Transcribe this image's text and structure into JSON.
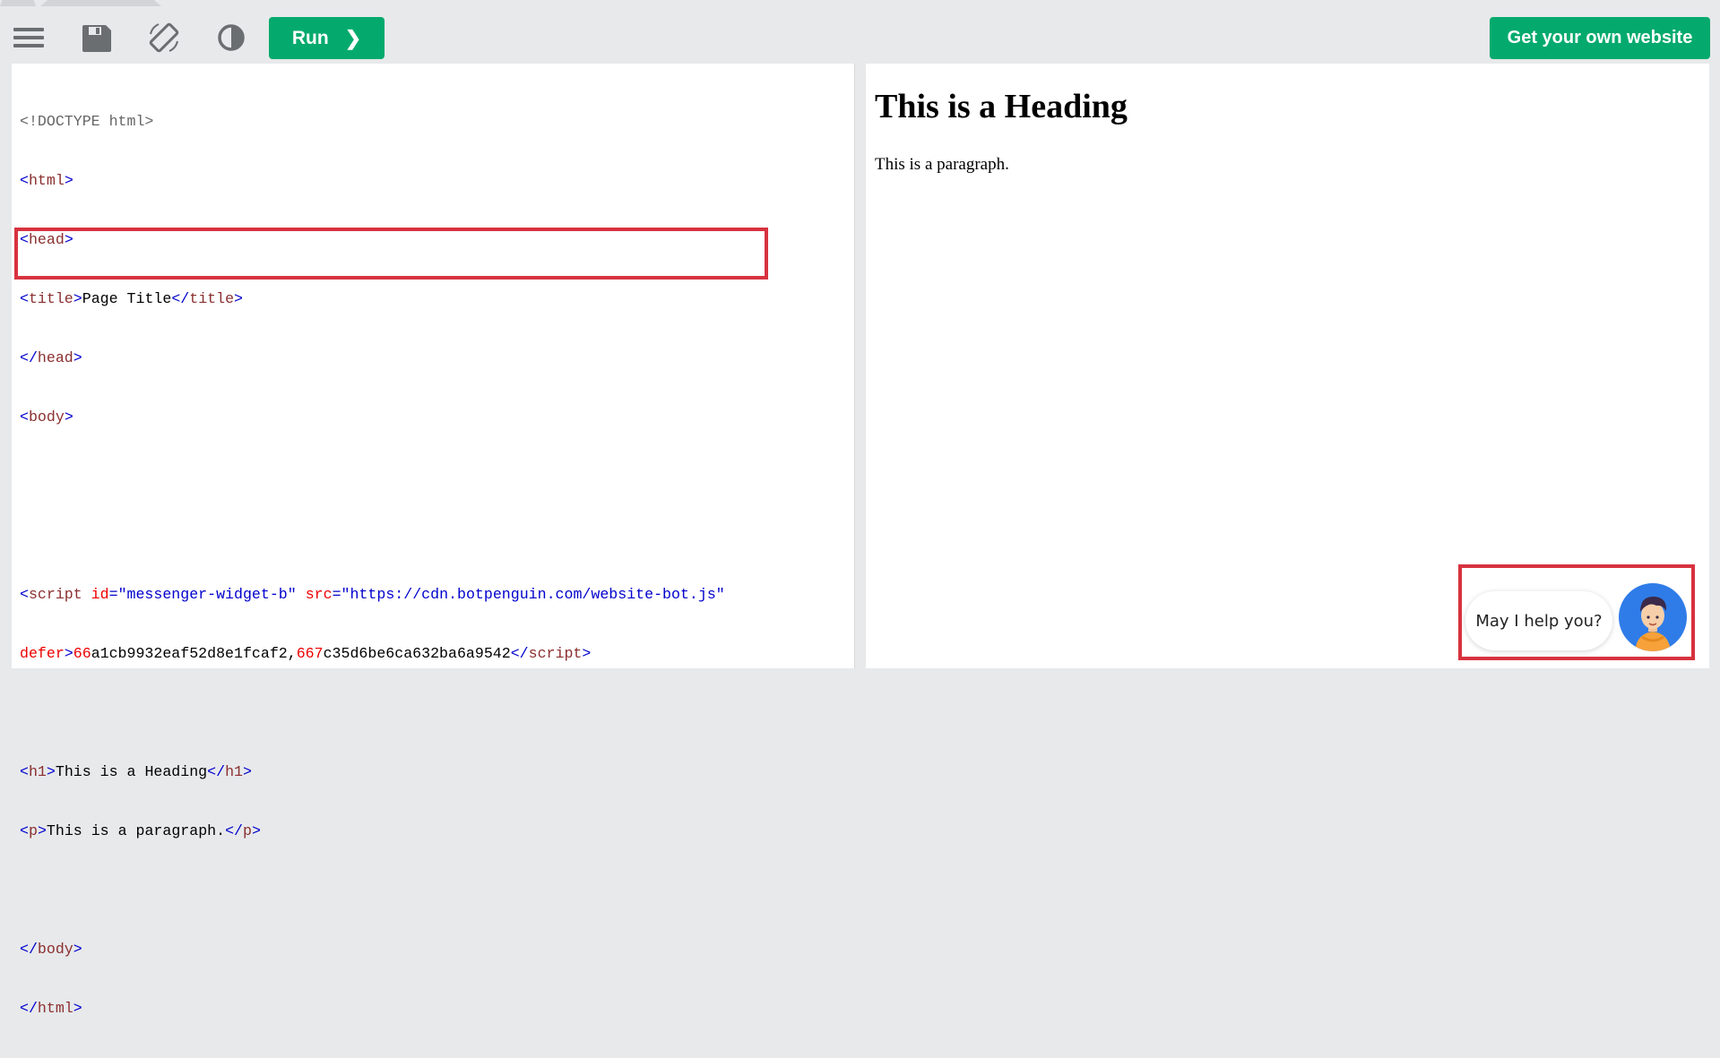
{
  "toolbar": {
    "run_label": "Run",
    "run_chevron": "❯",
    "own_website_label": "Get your own website",
    "icons": [
      "menu-icon",
      "save-icon",
      "rotate-icon",
      "theme-contrast-icon",
      "chevron-right-icon"
    ],
    "accent_color": "#04aa6d"
  },
  "editor": {
    "lines": {
      "l1": "<!DOCTYPE html>",
      "l2_open": "<",
      "l2_tag": "html",
      "l2_close": ">",
      "l3_open": "<",
      "l3_tag": "head",
      "l3_close": ">",
      "l4_open": "<",
      "l4_tag": "title",
      "l4_gt": ">",
      "l4_text": "Page Title",
      "l4_endopen": "</",
      "l4_endtag": "title",
      "l4_endgt": ">",
      "l5_open": "</",
      "l5_tag": "head",
      "l5_close": ">",
      "l6_open": "<",
      "l6_tag": "body",
      "l6_close": ">",
      "l9_open": "<",
      "l9_tag": "script",
      "l9_attr1": " id",
      "l9_eq1": "=",
      "l9_val1": "\"messenger-widget-b\"",
      "l9_attr2": " src",
      "l9_eq2": "=",
      "l9_val2": "\"https://cdn.botpenguin.com/website-bot.js\"",
      "l10_attr": "defer",
      "l10_gt": ">",
      "l10_num1": "66",
      "l10_t1": "a1cb9932eaf52d8e1fcaf2,",
      "l10_num2": "667",
      "l10_t2": "c35d6be6ca632ba6a9542",
      "l10_endopen": "</",
      "l10_endtag": "script",
      "l10_endgt": ">",
      "l12_open": "<",
      "l12_tag": "h1",
      "l12_gt": ">",
      "l12_text": "This is a Heading",
      "l12_endopen": "</",
      "l12_endtag": "h1",
      "l12_endgt": ">",
      "l13_open": "<",
      "l13_tag": "p",
      "l13_gt": ">",
      "l13_text": "This is a paragraph.",
      "l13_endopen": "</",
      "l13_endtag": "p",
      "l13_endgt": ">",
      "l15_open": "</",
      "l15_tag": "body",
      "l15_close": ">",
      "l16_open": "</",
      "l16_tag": "html",
      "l16_close": ">"
    },
    "highlight_color": "#d8323f"
  },
  "preview": {
    "heading": "This is a Heading",
    "paragraph": "This is a paragraph."
  },
  "chat_widget": {
    "bubble_text": "May I help you?",
    "avatar_icon": "bot-avatar-icon",
    "avatar_color": "#2f7ce8"
  }
}
